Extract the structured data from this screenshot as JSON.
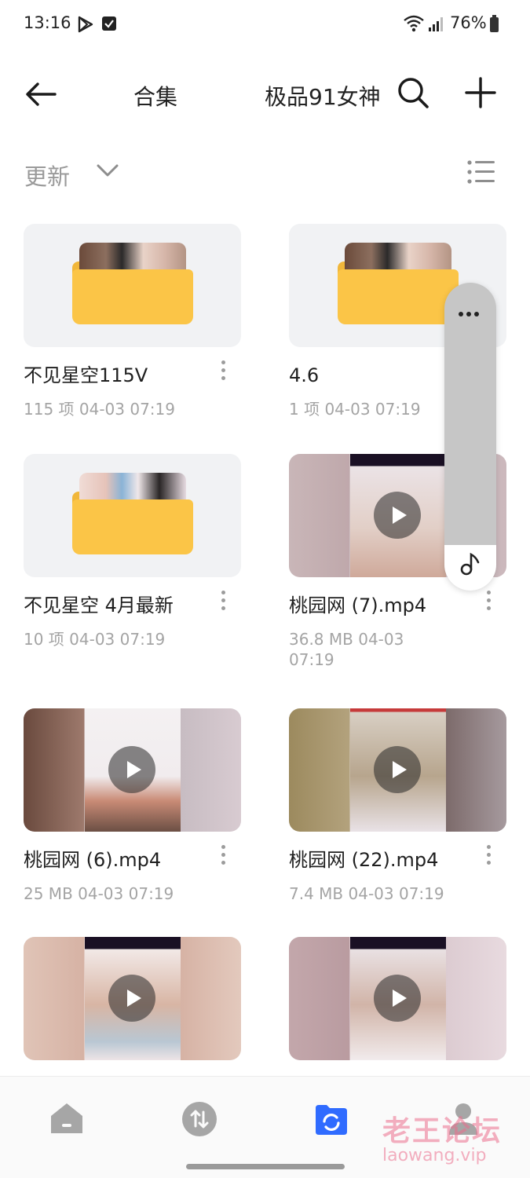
{
  "status_bar": {
    "time": "13:16",
    "battery": "76%"
  },
  "header": {
    "title_left": "合集",
    "title": "极品91女神"
  },
  "sort": {
    "label": "更新"
  },
  "files": [
    {
      "kind": "folder",
      "name": "不见星空115V",
      "meta": "115 项  04-03 07:19"
    },
    {
      "kind": "folder",
      "name": "4.6",
      "meta": "1 项  04-03 07:19"
    },
    {
      "kind": "folder",
      "name": "不见星空 4月最新",
      "meta": "10 项  04-03 07:19"
    },
    {
      "kind": "video",
      "name": "桃园网 (7).mp4",
      "meta": "36.8 MB  04-03 07:19"
    },
    {
      "kind": "video",
      "name": "桃园网 (6).mp4",
      "meta": "25 MB  04-03 07:19"
    },
    {
      "kind": "video",
      "name": "桃园网 (22).mp4",
      "meta": "7.4 MB  04-03 07:19"
    },
    {
      "kind": "video",
      "name": "",
      "meta": ""
    },
    {
      "kind": "video",
      "name": "",
      "meta": ""
    }
  ],
  "bottom_nav": [
    {
      "icon": "home-icon"
    },
    {
      "icon": "transfer-icon"
    },
    {
      "icon": "files-icon",
      "active": true
    },
    {
      "icon": "profile-icon"
    }
  ],
  "watermark": {
    "cn": "老王论坛",
    "en": "laowang.vip"
  },
  "colors": {
    "accent": "#2f6bff",
    "folder": "#fbc547",
    "meta_gray": "#a4a4a4"
  }
}
